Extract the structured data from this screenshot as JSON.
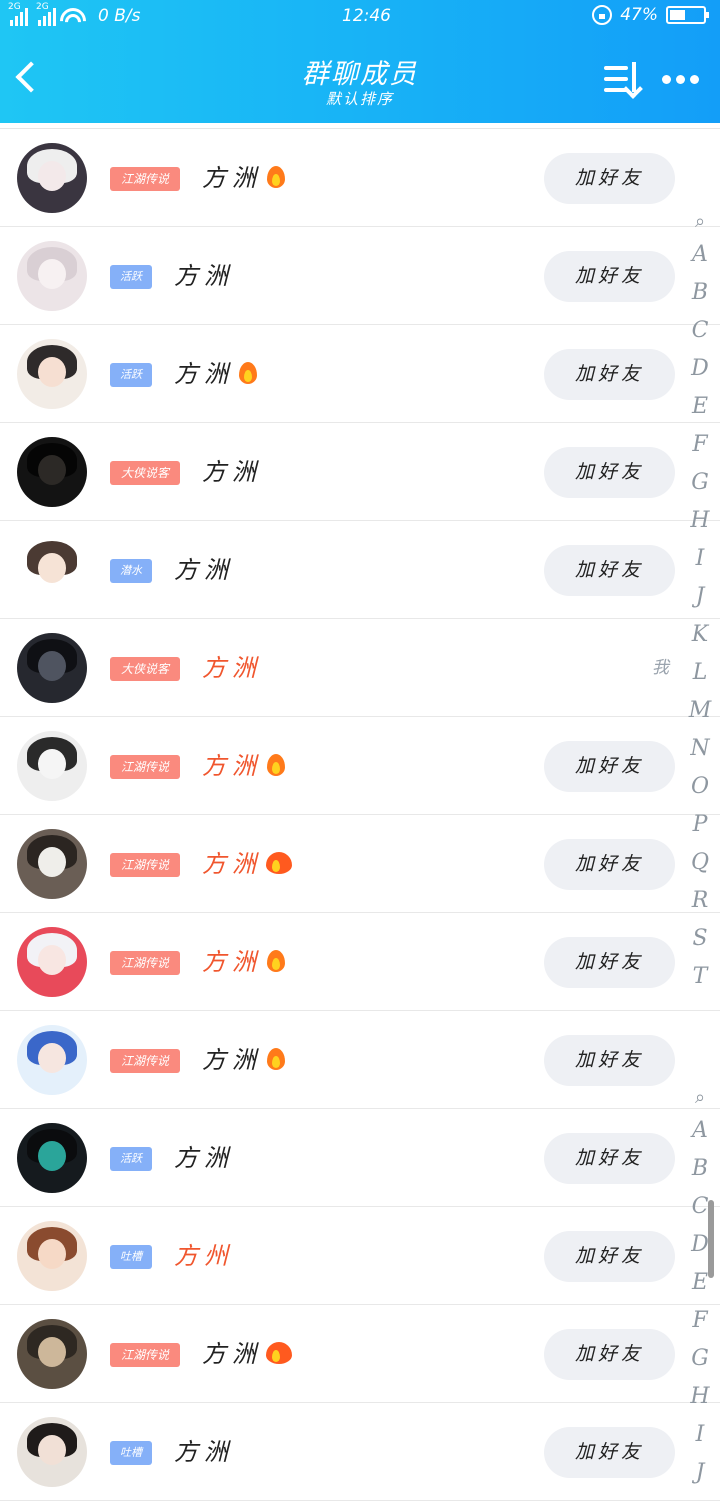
{
  "status_bar": {
    "sim1": "2G",
    "sim2": "2G",
    "speed": "0 B/s",
    "time": "12:46",
    "battery": "47%",
    "battery_level": 0.47
  },
  "header": {
    "title": "群聊成员",
    "subtitle": "默认排序",
    "icons": [
      "back-icon",
      "sort-icon",
      "more-icon"
    ]
  },
  "members": [
    {
      "avatar": "anime-girl-white-hair",
      "badge": "江湖传说",
      "badge_color": "red",
      "name": "方洲",
      "name_color": "dark",
      "flame": "small",
      "action": "加好友"
    },
    {
      "avatar": "pale-anime-sketch",
      "badge": "活跃",
      "badge_color": "blue",
      "name": "方洲",
      "name_color": "dark",
      "flame": "",
      "action": "加好友"
    },
    {
      "avatar": "couple-photo",
      "badge": "活跃",
      "badge_color": "blue",
      "name": "方洲",
      "name_color": "dark",
      "flame": "small",
      "action": "加好友"
    },
    {
      "avatar": "dark-figure",
      "badge": "大侠说客",
      "badge_color": "red",
      "name": "方洲",
      "name_color": "dark",
      "flame": "",
      "action": "加好友"
    },
    {
      "avatar": "chibi-girl",
      "badge": "潜水",
      "badge_color": "blue",
      "name": "方洲",
      "name_color": "dark",
      "flame": "",
      "action": "加好友"
    },
    {
      "avatar": "silhouette-window",
      "badge": "大侠说客",
      "badge_color": "red",
      "name": "方洲",
      "name_color": "orange",
      "flame": "",
      "action": "",
      "self_label": "我"
    },
    {
      "avatar": "manga-couple",
      "badge": "江湖传说",
      "badge_color": "red",
      "name": "方洲",
      "name_color": "orange",
      "flame": "small",
      "action": "加好友"
    },
    {
      "avatar": "dog-face",
      "badge": "江湖传说",
      "badge_color": "red",
      "name": "方洲",
      "name_color": "orange",
      "flame": "big",
      "action": "加好友"
    },
    {
      "avatar": "anime-girl-red",
      "badge": "江湖传说",
      "badge_color": "red",
      "name": "方洲",
      "name_color": "orange",
      "flame": "small",
      "action": "加好友"
    },
    {
      "avatar": "anime-boy-blue",
      "badge": "江湖传说",
      "badge_color": "red",
      "name": "方洲",
      "name_color": "dark",
      "flame": "small",
      "action": "加好友"
    },
    {
      "avatar": "night-lights",
      "badge": "活跃",
      "badge_color": "blue",
      "name": "方洲",
      "name_color": "dark",
      "flame": "",
      "action": "加好友"
    },
    {
      "avatar": "anime-girl-brown",
      "badge": "吐槽",
      "badge_color": "blue",
      "name": "方州",
      "name_color": "orange",
      "flame": "",
      "action": "加好友"
    },
    {
      "avatar": "dog-photo",
      "badge": "江湖传说",
      "badge_color": "red",
      "name": "方洲",
      "name_color": "dark",
      "flame": "big",
      "action": "加好友"
    },
    {
      "avatar": "anime-dark-girl",
      "badge": "吐槽",
      "badge_color": "blue",
      "name": "方洲",
      "name_color": "dark",
      "flame": "",
      "action": "加好友"
    }
  ],
  "index_upper": [
    "A",
    "B",
    "C",
    "D",
    "E",
    "F",
    "G",
    "H",
    "I",
    "J",
    "K",
    "L",
    "M",
    "N",
    "O",
    "P",
    "Q",
    "R",
    "S",
    "T"
  ],
  "index_lower": [
    "A",
    "B",
    "C",
    "D",
    "E",
    "F",
    "G",
    "H",
    "I",
    "J"
  ],
  "colors": {
    "header_start": "#1fc6f4",
    "header_end": "#139ef8",
    "badge_red": "#fa8a7e",
    "badge_blue": "#85b0f8",
    "name_orange": "#f0562e",
    "button_bg": "#eef0f4",
    "index_text": "#8e97a0"
  }
}
